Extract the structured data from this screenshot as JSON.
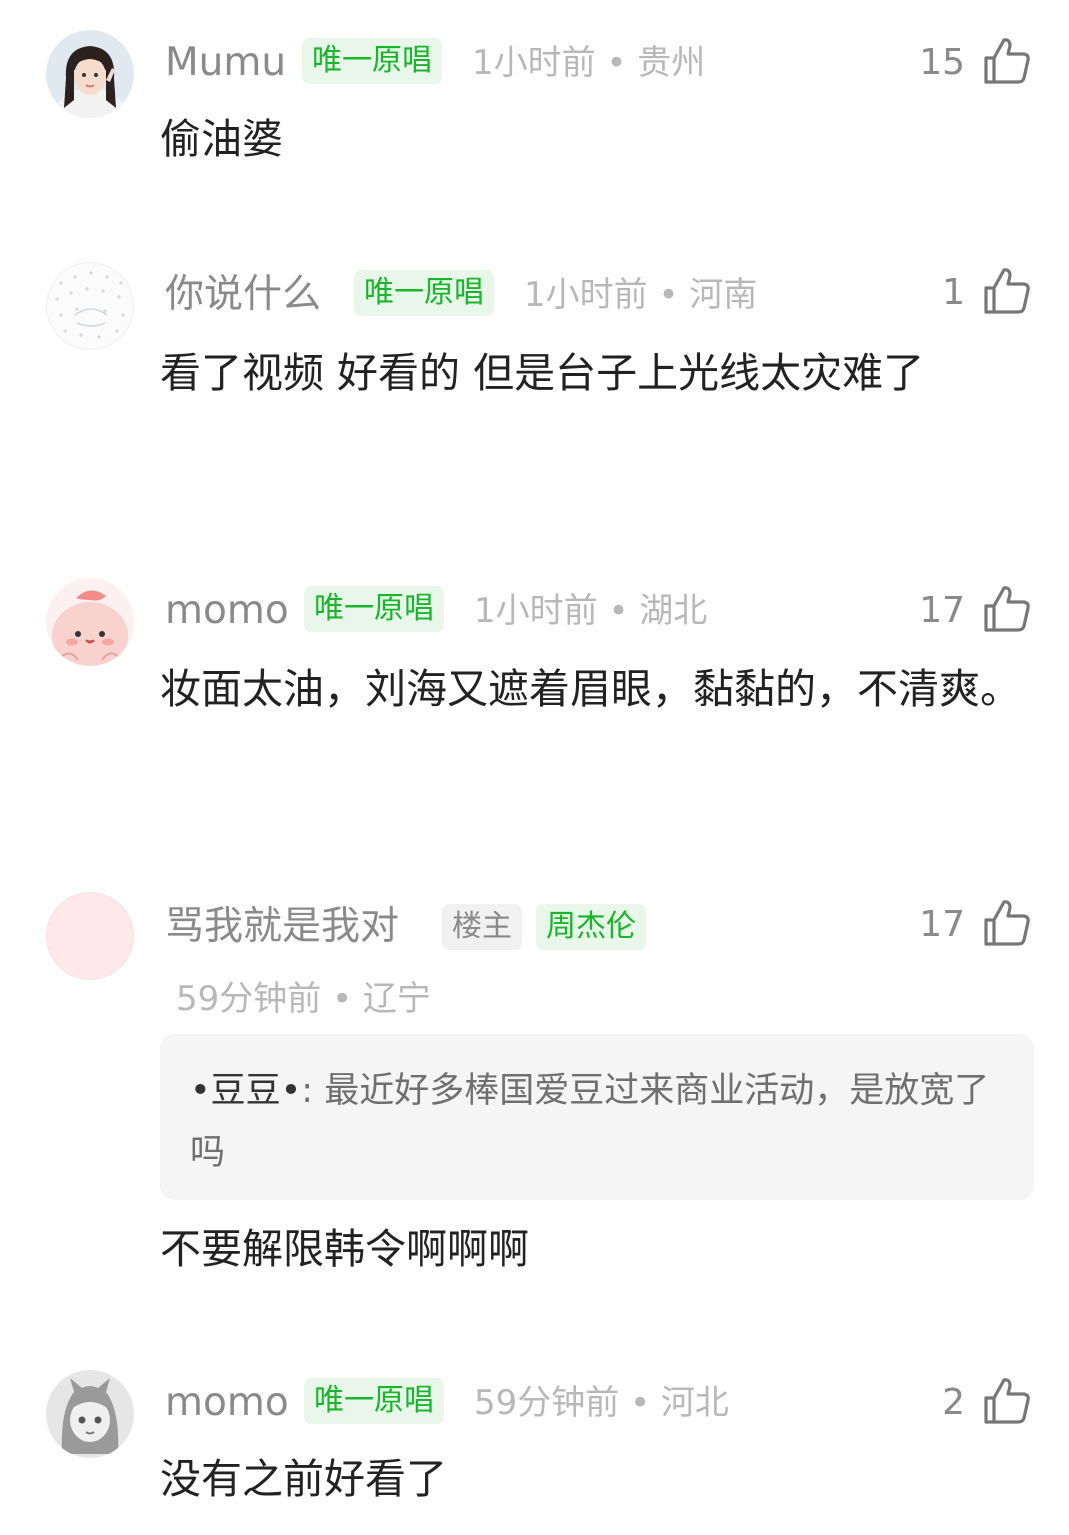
{
  "comments": [
    {
      "username": "Mumu",
      "badges": [
        "唯一原唱"
      ],
      "meta": "1小时前 • 贵州",
      "likes": "15",
      "text": "偷油婆",
      "avatar_icon": "girl-photo-avatar"
    },
    {
      "username": "你说什么",
      "badges": [
        "唯一原唱"
      ],
      "meta": "1小时前 • 河南",
      "likes": "1",
      "text": "看了视频 好看的 但是台子上光线太灾难了",
      "avatar_icon": "dotted-pattern-avatar"
    },
    {
      "username": "momo",
      "badges": [
        "唯一原唱"
      ],
      "meta": "1小时前 • 湖北",
      "likes": "17",
      "text": "妆面太油，刘海又遮着眉眼，黏黏的，不清爽。",
      "avatar_icon": "pink-cartoon-avatar"
    },
    {
      "username": "骂我就是我对",
      "badges": [
        "楼主",
        "周杰伦"
      ],
      "meta": "59分钟前 • 辽宁",
      "likes": "17",
      "quote_name": "•豆豆•",
      "quote_text": ": 最近好多棒国爱豆过来商业活动，是放宽了吗",
      "text": "不要解限韩令啊啊啊",
      "avatar_icon": "pink-blank-avatar"
    },
    {
      "username": "momo",
      "badges": [
        "唯一原唱"
      ],
      "meta": "59分钟前 • 河北",
      "likes": "2",
      "text": "没有之前好看了",
      "avatar_icon": "gray-cartoon-avatar"
    }
  ],
  "colors": {
    "badge_green_bg": "#e9f7ea",
    "badge_green_text": "#19b52a",
    "meta_text": "#b8b8b8",
    "name_text": "#8a8a8a",
    "body_text": "#222222"
  }
}
